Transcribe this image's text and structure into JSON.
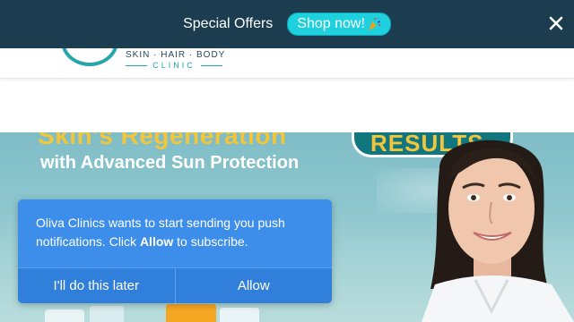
{
  "header": {
    "logo_tagline": "SKIN · HAIR · BODY",
    "logo_clinic": "CLINIC"
  },
  "offer_bar": {
    "text": "Special Offers",
    "shop_label": "Shop now!",
    "shop_icon": "party-popper-icon",
    "close_icon": "close-icon",
    "background_color": "#1c3d4f",
    "button_color": "#1fd0df"
  },
  "hero": {
    "headline": "Skin's Regeneration",
    "subheadline": "with Advanced Sun Protection",
    "badge_text": "RESULTS",
    "accent_color": "#f2c53a"
  },
  "push_prompt": {
    "message_before": "Oliva Clinics wants to start sending you push notifications. Click",
    "message_bold": "Allow",
    "message_after": "to subscribe.",
    "later_label": "I'll do this later",
    "allow_label": "Allow",
    "background_color": "#3d8eea"
  }
}
